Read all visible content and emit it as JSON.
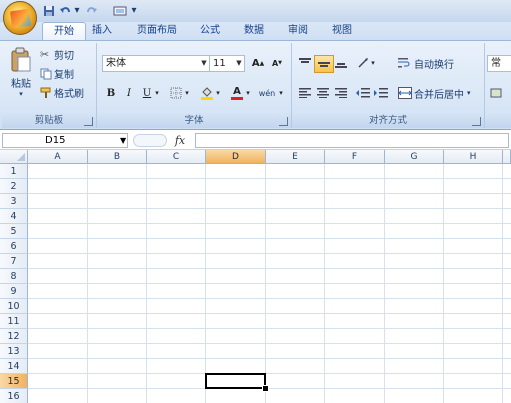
{
  "ribbon_tabs": [
    "开始",
    "插入",
    "页面布局",
    "公式",
    "数据",
    "审阅",
    "视图"
  ],
  "clipboard": {
    "paste": "粘贴",
    "cut": "剪切",
    "copy": "复制",
    "format_painter": "格式刷",
    "group_label": "剪贴板"
  },
  "font": {
    "name": "宋体",
    "size": "11",
    "bold": "B",
    "italic": "I",
    "underline": "U",
    "group_label": "字体"
  },
  "alignment": {
    "wrap_text": "自动换行",
    "merge_center": "合并后居中",
    "group_label": "对齐方式"
  },
  "number": {
    "format_partial": "常"
  },
  "name_box": "D15",
  "fx_label": "fx",
  "columns": [
    "A",
    "B",
    "C",
    "D",
    "E",
    "F",
    "G",
    "H"
  ],
  "rows": [
    "1",
    "2",
    "3",
    "4",
    "5",
    "6",
    "7",
    "8",
    "9",
    "10",
    "11",
    "12",
    "13",
    "14",
    "15",
    "16"
  ],
  "selected": {
    "column": "D",
    "row": "15"
  },
  "colors": {
    "accent": "#15428b",
    "selection_header": "#f1b25f",
    "ribbon_bg": "#dde9f7"
  }
}
